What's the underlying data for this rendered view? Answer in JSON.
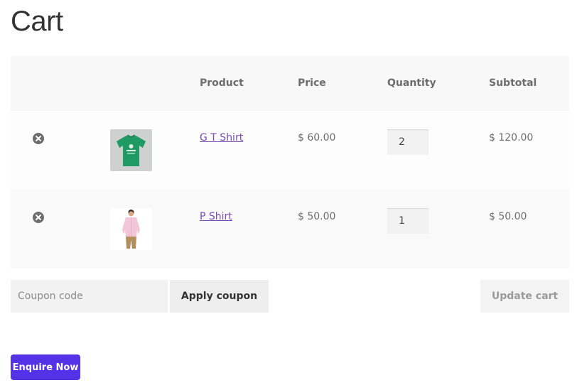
{
  "page": {
    "title": "Cart"
  },
  "table": {
    "headers": [
      "Product",
      "Price",
      "Quantity",
      "Subtotal"
    ],
    "rows": [
      {
        "name": "G T Shirt",
        "price": "$ 60.00",
        "quantity": "2",
        "subtotal": "$ 120.00",
        "image": "green-tshirt-image"
      },
      {
        "name": "P Shirt",
        "price": "$ 50.00",
        "quantity": "1",
        "subtotal": "$ 50.00",
        "image": "pink-shirt-model-image"
      }
    ]
  },
  "actions": {
    "coupon_placeholder": "Coupon code",
    "apply_coupon": "Apply coupon",
    "update_cart": "Update cart",
    "enquire_now": "Enquire Now"
  },
  "colors": {
    "accent": "#5433e6",
    "link": "#7a4bb0",
    "tshirt": "#1f9a62",
    "shirt": "#f2c6d6"
  }
}
